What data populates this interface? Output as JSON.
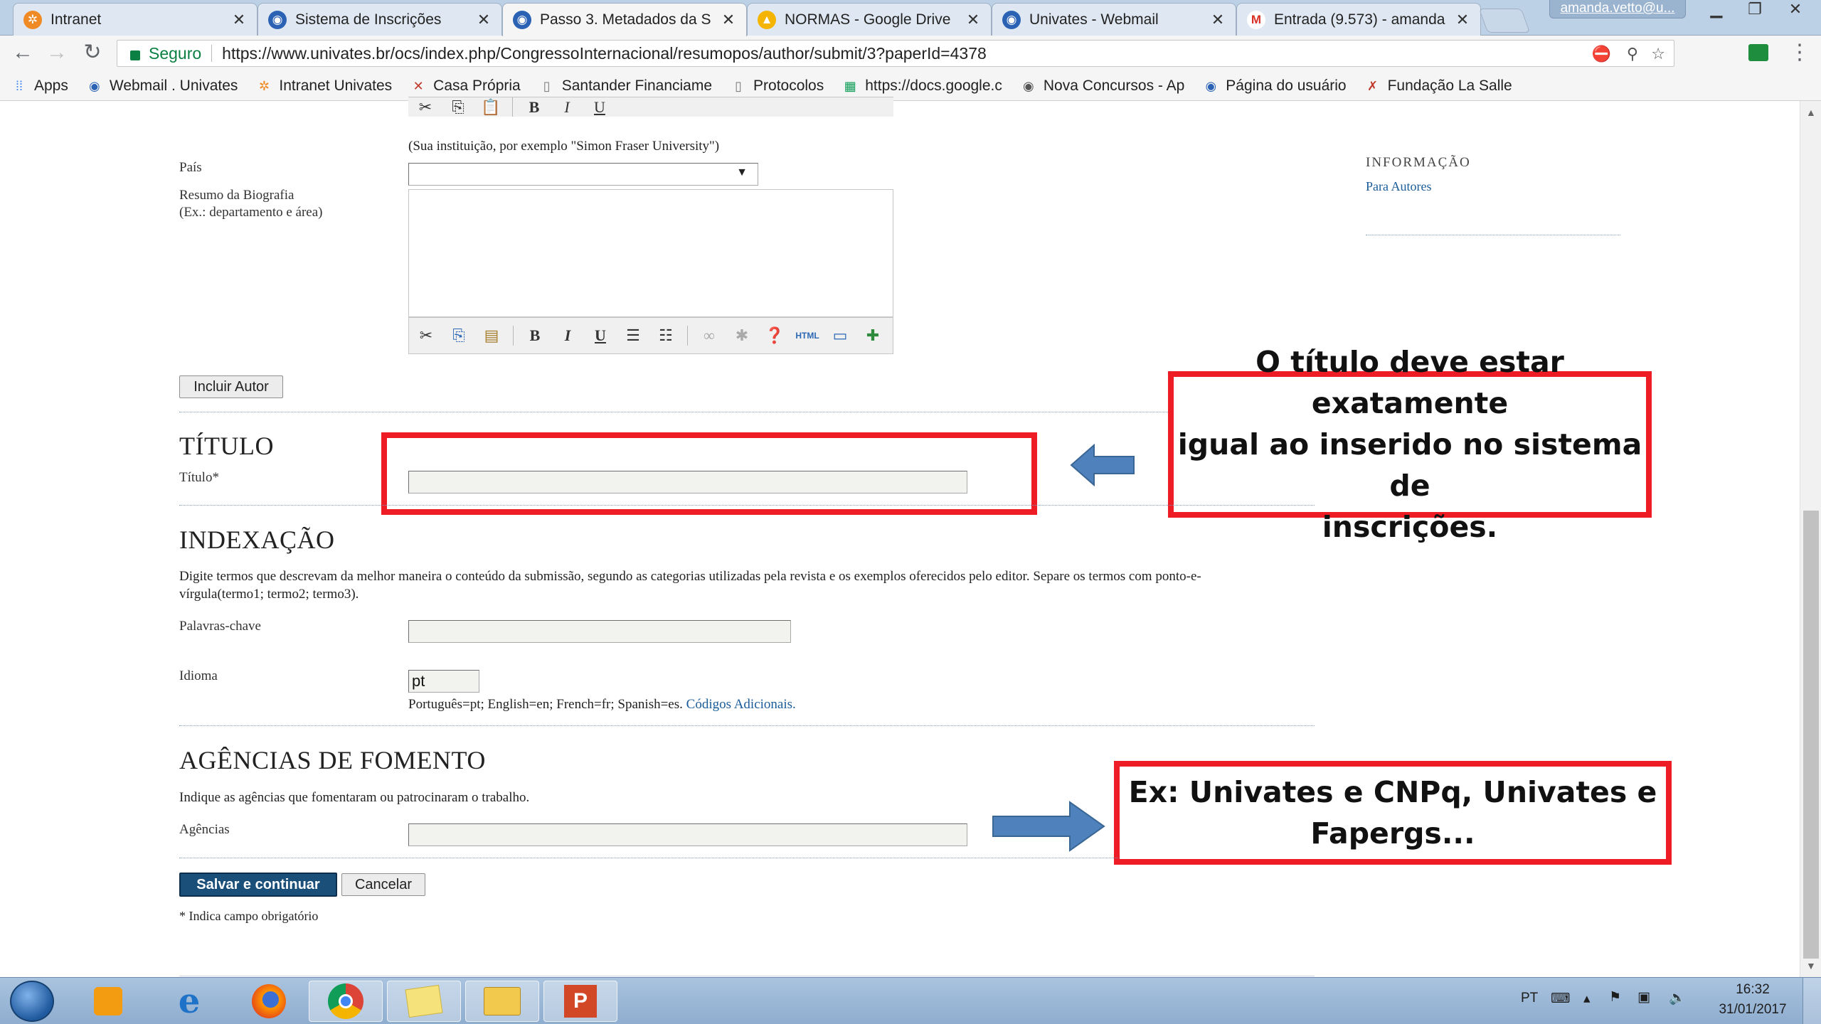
{
  "browser": {
    "tabs": [
      {
        "label": "Intranet",
        "icon": "intranet-logo-icon",
        "active": false
      },
      {
        "label": "Sistema de Inscrições",
        "icon": "ocs-globe-icon",
        "active": false
      },
      {
        "label": "Passo 3. Metadados da S",
        "icon": "ocs-globe-icon",
        "active": true
      },
      {
        "label": "NORMAS - Google Drive",
        "icon": "google-drive-icon",
        "active": false
      },
      {
        "label": "Univates - Webmail",
        "icon": "ocs-globe-icon",
        "active": false
      },
      {
        "label": "Entrada (9.573) - amanda",
        "icon": "gmail-icon",
        "active": false
      }
    ],
    "profile_name": "amanda.vetto@u...",
    "omnibox": {
      "secure_label": "Seguro",
      "url": "https://www.univates.br/ocs/index.php/CongressoInternacional/resumopos/author/submit/3?paperId=4378"
    },
    "bookmarks": [
      {
        "label": "Apps",
        "icon": "apps-grid-icon"
      },
      {
        "label": "Webmail . Univates",
        "icon": "globe-icon"
      },
      {
        "label": "Intranet Univates",
        "icon": "intranet-logo-icon"
      },
      {
        "label": "Casa Própria",
        "icon": "bookmark-icon"
      },
      {
        "label": "Santander Financiame",
        "icon": "page-icon"
      },
      {
        "label": "Protocolos",
        "icon": "page-icon"
      },
      {
        "label": "https://docs.google.c",
        "icon": "sheets-icon"
      },
      {
        "label": "Nova Concursos - Ap",
        "icon": "globe-icon"
      },
      {
        "label": "Página do usuário",
        "icon": "globe-icon"
      },
      {
        "label": "Fundação La Salle",
        "icon": "bookmark-icon"
      }
    ]
  },
  "form": {
    "institution_hint": "(Sua instituição, por exemplo \"Simon Fraser University\")",
    "country_label": "País",
    "bio_label_line1": "Resumo da Biografia",
    "bio_label_line2": "(Ex.: departamento e área)",
    "add_author_button": "Incluir Autor",
    "title_section_heading": "TÍTULO",
    "title_label": "Título*",
    "title_value": "",
    "indexing_heading": "INDEXAÇÃO",
    "indexing_desc_line1": "Digite termos que descrevam da melhor maneira o conteúdo da submissão, segundo as categorias utilizadas pela revista e os exemplos oferecidos pelo editor. Separe os termos com ponto-e-",
    "indexing_desc_line2": "vírgula(termo1; termo2; termo3).",
    "keywords_label": "Palavras-chave",
    "keywords_value": "",
    "language_label": "Idioma",
    "language_value": "pt",
    "language_hint": "Português=pt; English=en; French=fr; Spanish=es.",
    "language_link": "Códigos Adicionais.",
    "funding_heading": "AGÊNCIAS DE FOMENTO",
    "funding_desc": "Indique as agências que fomentaram ou patrocinaram o trabalho.",
    "agencies_label": "Agências",
    "agencies_value": "",
    "save_button": "Salvar e continuar",
    "cancel_button": "Cancelar",
    "required_note": "* Indica campo obrigatório"
  },
  "sidebar": {
    "info_heading": "INFORMAÇÃO",
    "info_link": "Para Autores"
  },
  "annotations": {
    "title_note": [
      "O título deve estar exatamente",
      "igual ao inserido no sistema de",
      "inscrições."
    ],
    "funding_note": [
      "Ex: Univates e CNPq, Univates e",
      "Fapergs..."
    ]
  },
  "taskbar": {
    "apps": [
      "start-orb-icon",
      "media-player-icon",
      "internet-explorer-icon",
      "firefox-icon",
      "chrome-icon",
      "sticky-notes-icon",
      "file-explorer-icon",
      "powerpoint-icon"
    ],
    "language": "PT",
    "time": "16:32",
    "date": "31/01/2017"
  },
  "colors": {
    "annotation_red": "#ee1c24",
    "arrow_blue": "#4f81bd",
    "primary_button": "#1a4f7a",
    "link": "#1a5c99"
  }
}
